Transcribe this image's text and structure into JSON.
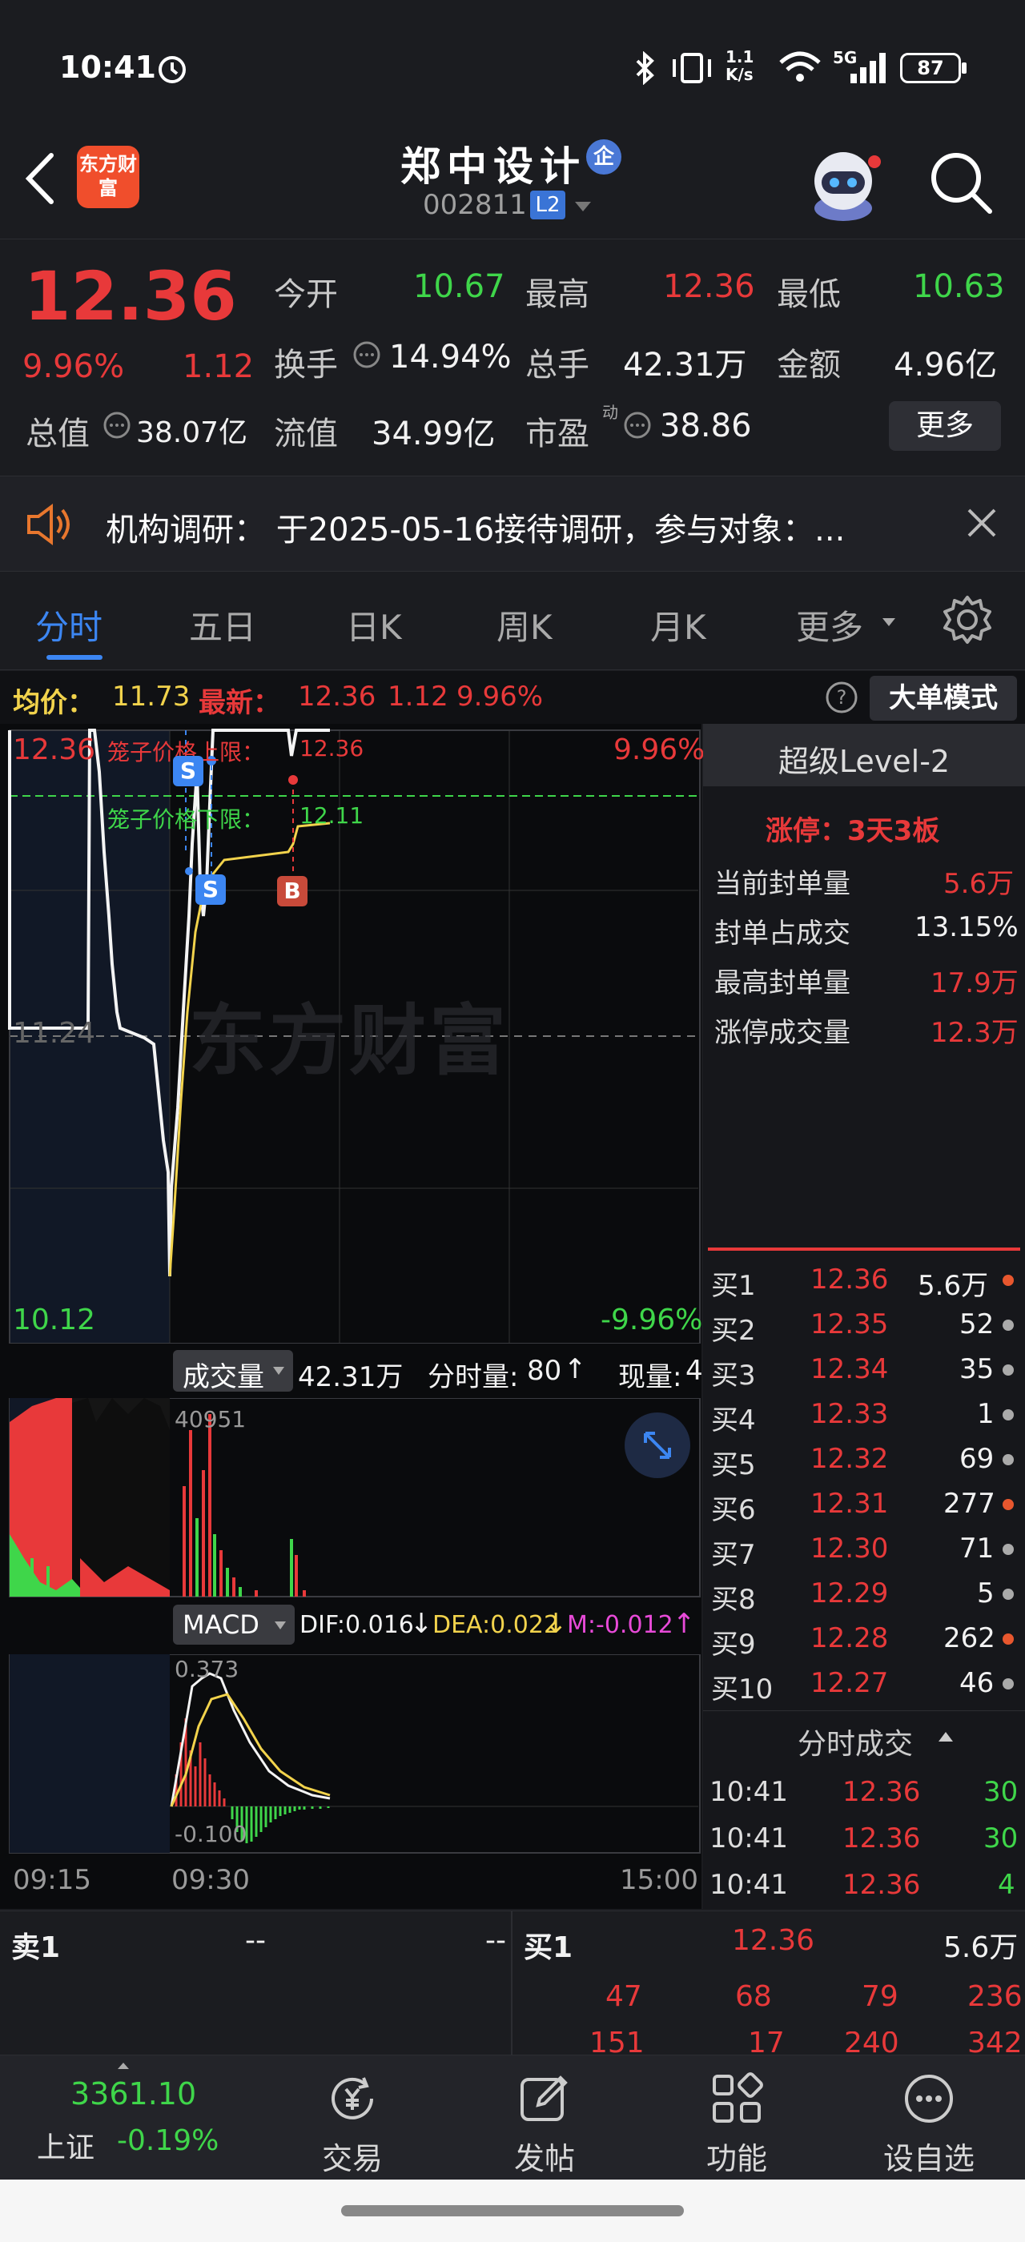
{
  "status_bar": {
    "time": "10:41",
    "net_speed": "1.1\nK/s",
    "signal": "5G",
    "battery": "87"
  },
  "header": {
    "logo_text": "东方财富",
    "stock_name": "郑中设计",
    "badge": "企",
    "stock_code": "002811",
    "level_tag": "L2"
  },
  "quote": {
    "price": "12.36",
    "change_pct": "9.96%",
    "change_amt": "1.12",
    "open_label": "今开",
    "open": "10.67",
    "high_label": "最高",
    "high": "12.36",
    "low_label": "最低",
    "low": "10.63",
    "turnover_label": "换手",
    "turnover": "14.94%",
    "volume_label": "总手",
    "volume": "42.31万",
    "amount_label": "金额",
    "amount": "4.96亿",
    "mktcap_label": "总值",
    "mktcap": "38.07亿",
    "float_label": "流值",
    "float_cap": "34.99亿",
    "pe_label": "市盈",
    "pe_sup": "动",
    "pe": "38.86",
    "more_button": "更多"
  },
  "notice": {
    "text": "机构调研： 于2025-05-16接待调研，参与对象：..."
  },
  "tabs": [
    "分时",
    "五日",
    "日K",
    "周K",
    "月K",
    "更多"
  ],
  "chart_info": {
    "avg_label": "均价：",
    "avg": "11.73",
    "last_label": "最新：",
    "last": "12.36",
    "last_change": "1.12",
    "last_pct": "9.96%",
    "mode_button": "大单模式"
  },
  "intraday": {
    "price_top": "12.36",
    "price_mid": "11.24",
    "price_bottom": "10.12",
    "pct_top": "9.96%",
    "pct_bottom": "-9.96%",
    "upper_limit_label": "笼子价格上限：",
    "upper_limit": "12.36",
    "lower_limit_label": "笼子价格下限：",
    "lower_limit": "12.11",
    "watermark": "东方财富",
    "volume_selector": "成交量",
    "volume_total": "42.31万",
    "tick_vol_label": "分时量:",
    "tick_vol": "80",
    "cur_vol_label": "现量:",
    "cur_vol": "4",
    "volume_peak": "40951",
    "macd_selector": "MACD",
    "dif": "DIF:0.016",
    "dea": "DEA:0.022",
    "m": "M:-0.012",
    "macd_top": "0.373",
    "macd_bottom": "-0.100",
    "time_start": "09:15",
    "time_open": "09:30",
    "time_end": "15:00"
  },
  "level2": {
    "title": "超级Level-2",
    "limit_status": "涨停：3天3板",
    "stats": [
      {
        "label": "当前封单量",
        "value": "5.6万"
      },
      {
        "label": "封单占成交",
        "value": "13.15%"
      },
      {
        "label": "最高封单量",
        "value": "17.9万"
      },
      {
        "label": "涨停成交量",
        "value": "12.3万"
      }
    ],
    "bids": [
      {
        "label": "买1",
        "price": "12.36",
        "qty": "5.6万"
      },
      {
        "label": "买2",
        "price": "12.35",
        "qty": "52"
      },
      {
        "label": "买3",
        "price": "12.34",
        "qty": "35"
      },
      {
        "label": "买4",
        "price": "12.33",
        "qty": "1"
      },
      {
        "label": "买5",
        "price": "12.32",
        "qty": "69"
      },
      {
        "label": "买6",
        "price": "12.31",
        "qty": "277"
      },
      {
        "label": "买7",
        "price": "12.30",
        "qty": "71"
      },
      {
        "label": "买8",
        "price": "12.29",
        "qty": "5"
      },
      {
        "label": "买9",
        "price": "12.28",
        "qty": "262"
      },
      {
        "label": "买10",
        "price": "12.27",
        "qty": "46"
      }
    ],
    "ticks_title": "分时成交",
    "ticks": [
      {
        "time": "10:41",
        "price": "12.36",
        "qty": "30"
      },
      {
        "time": "10:41",
        "price": "12.36",
        "qty": "30"
      },
      {
        "time": "10:41",
        "price": "12.36",
        "qty": "4"
      }
    ]
  },
  "book": {
    "sell1_label": "卖1",
    "sell1_price": "--",
    "sell1_qty": "--",
    "buy1_label": "买1",
    "buy1_price": "12.36",
    "buy1_qty": "5.6万",
    "queue": [
      "47",
      "68",
      "79",
      "236"
    ],
    "queue2": [
      "151",
      "17",
      "240",
      "342"
    ]
  },
  "bottom_nav": {
    "index_value": "3361.10",
    "index_name": "上证",
    "index_pct": "-0.19%",
    "items": [
      "交易",
      "发帖",
      "功能",
      "设自选"
    ]
  }
}
